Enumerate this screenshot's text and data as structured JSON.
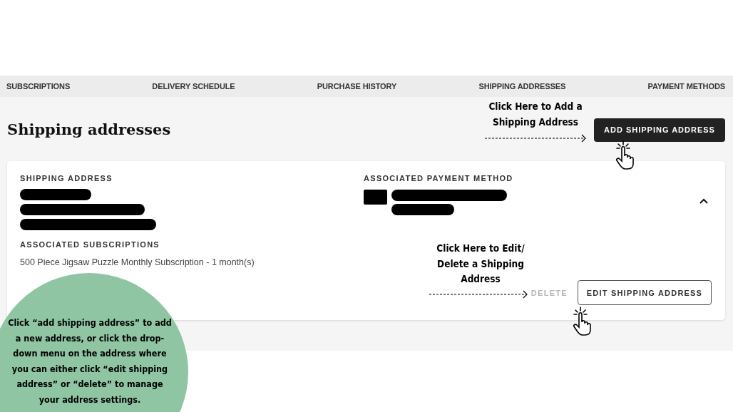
{
  "nav": {
    "tabs": [
      {
        "label": "SUBSCRIPTIONS"
      },
      {
        "label": "DELIVERY SCHEDULE"
      },
      {
        "label": "PURCHASE HISTORY"
      },
      {
        "label": "SHIPPING ADDRESSES"
      },
      {
        "label": "PAYMENT METHODS"
      }
    ]
  },
  "page": {
    "title": "Shipping addresses",
    "add_button": "ADD SHIPPING ADDRESS"
  },
  "address_card": {
    "expanded": true,
    "shipping_address": {
      "label": "SHIPPING ADDRESS"
    },
    "payment_method": {
      "label": "ASSOCIATED PAYMENT METHOD"
    },
    "subscriptions": {
      "label": "ASSOCIATED SUBSCRIPTIONS",
      "items": [
        "500 Piece Jigsaw Puzzle Monthly Subscription - 1 month(s)"
      ]
    },
    "delete_button": {
      "label": "DELETE",
      "disabled": true
    },
    "edit_button": {
      "label": "EDIT SHIPPING ADDRESS"
    }
  },
  "annotations": {
    "add_note": "Click Here to Add a Shipping Address",
    "edit_note": "Click Here to Edit/ Delete a Shipping Address",
    "help_bubble": "Click “add shipping address” to add a new address, or click the drop-down menu on the address where you can either click “edit shipping address” or “delete” to manage your address settings."
  }
}
